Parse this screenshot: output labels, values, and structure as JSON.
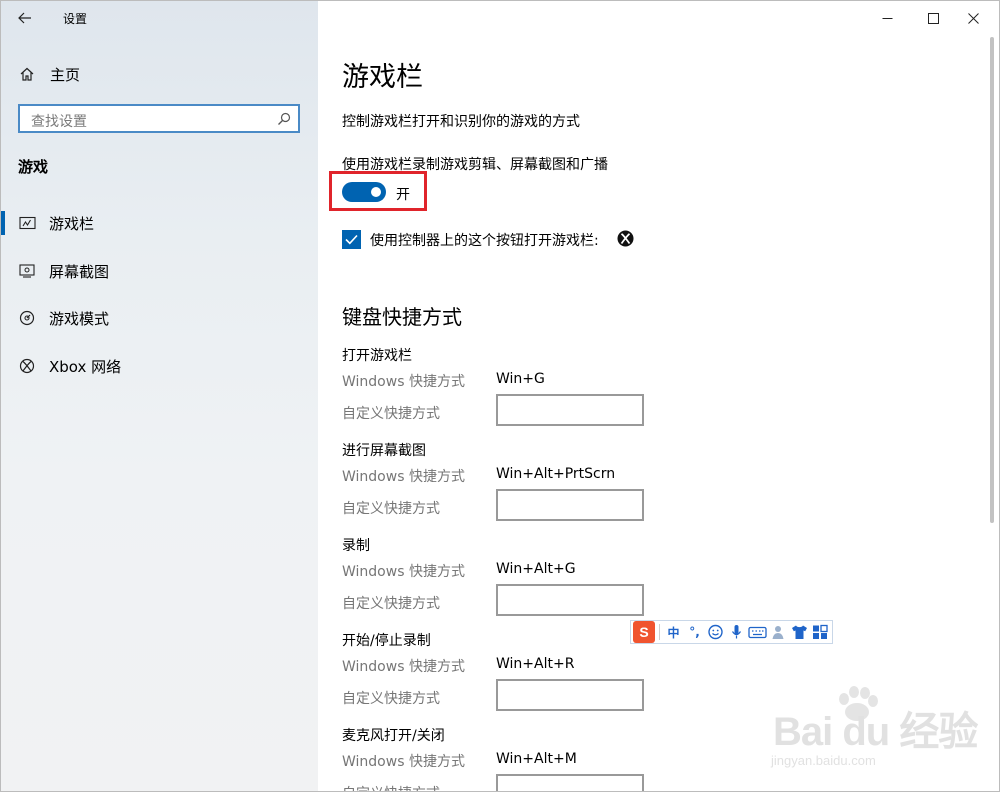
{
  "window": {
    "app_title": "设置",
    "controls": [
      "minimize-icon",
      "maximize-icon",
      "close-icon"
    ]
  },
  "sidebar": {
    "home_label": "主页",
    "search_placeholder": "查找设置",
    "section_title": "游戏",
    "items": [
      {
        "label": "游戏栏",
        "icon": "game-bar-icon",
        "selected": true
      },
      {
        "label": "屏幕截图",
        "icon": "screenshot-icon",
        "selected": false
      },
      {
        "label": "游戏模式",
        "icon": "game-mode-icon",
        "selected": false
      },
      {
        "label": "Xbox 网络",
        "icon": "xbox-icon",
        "selected": false
      }
    ]
  },
  "main": {
    "title": "游戏栏",
    "description": "控制游戏栏打开和识别你的游戏的方式",
    "toggle_description": "使用游戏栏录制游戏剪辑、屏幕截图和广播",
    "toggle_state": "开",
    "checkbox_label": "使用控制器上的这个按钮打开游戏栏:",
    "checkbox_checked": true,
    "keyboard_heading": "键盘快捷方式",
    "win_label": "Windows 快捷方式",
    "custom_label": "自定义快捷方式",
    "shortcuts": [
      {
        "title": "打开游戏栏",
        "win": "Win+G"
      },
      {
        "title": "进行屏幕截图",
        "win": "Win+Alt+PrtScrn"
      },
      {
        "title": "录制",
        "win": "Win+Alt+G"
      },
      {
        "title": "开始/停止录制",
        "win": "Win+Alt+R"
      },
      {
        "title": "麦克风打开/关闭",
        "win": "Win+Alt+M"
      }
    ]
  },
  "ime": {
    "items": [
      "中",
      "°,"
    ]
  },
  "watermark": {
    "brand": "Bai du 经验",
    "url": "jingyan.baidu.com"
  },
  "colors": {
    "accent": "#0063b1",
    "highlight": "#e0242b",
    "muted_text": "#767676"
  }
}
